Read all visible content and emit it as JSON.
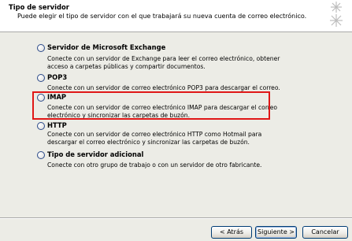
{
  "header": {
    "title": "Tipo de servidor",
    "subtitle": "Puede elegir el tipo de servidor con el que trabajará su nueva cuenta de correo electrónico."
  },
  "options": [
    {
      "label": "Servidor de Microsoft Exchange",
      "line1": "Conecte con un servidor de Exchange para leer el correo electrónico, obtener",
      "line2": "acceso a carpetas públicas y compartir documentos."
    },
    {
      "label": "POP3",
      "line1": "Conecte con un servidor de correo electrónico POP3 para descargar el correo.",
      "line2": ""
    },
    {
      "label": "IMAP",
      "line1": "Conecte con un servidor de correo electrónico IMAP para descargar el correo",
      "line2": "electrónico y sincronizar las carpetas de buzón."
    },
    {
      "label": "HTTP",
      "line1": "Conecte con un servidor de correo electrónico HTTP como Hotmail para",
      "line2": "descargar el correo electrónico y sincronizar las carpetas de buzón."
    },
    {
      "label": "Tipo de servidor adicional",
      "line1": "Conecte con otro grupo de trabajo o con un servidor de otro fabricante.",
      "line2": ""
    }
  ],
  "buttons": {
    "back": "< Atrás",
    "next": "Siguiente >",
    "cancel": "Cancelar"
  },
  "colors": {
    "highlight": "#e01717"
  }
}
